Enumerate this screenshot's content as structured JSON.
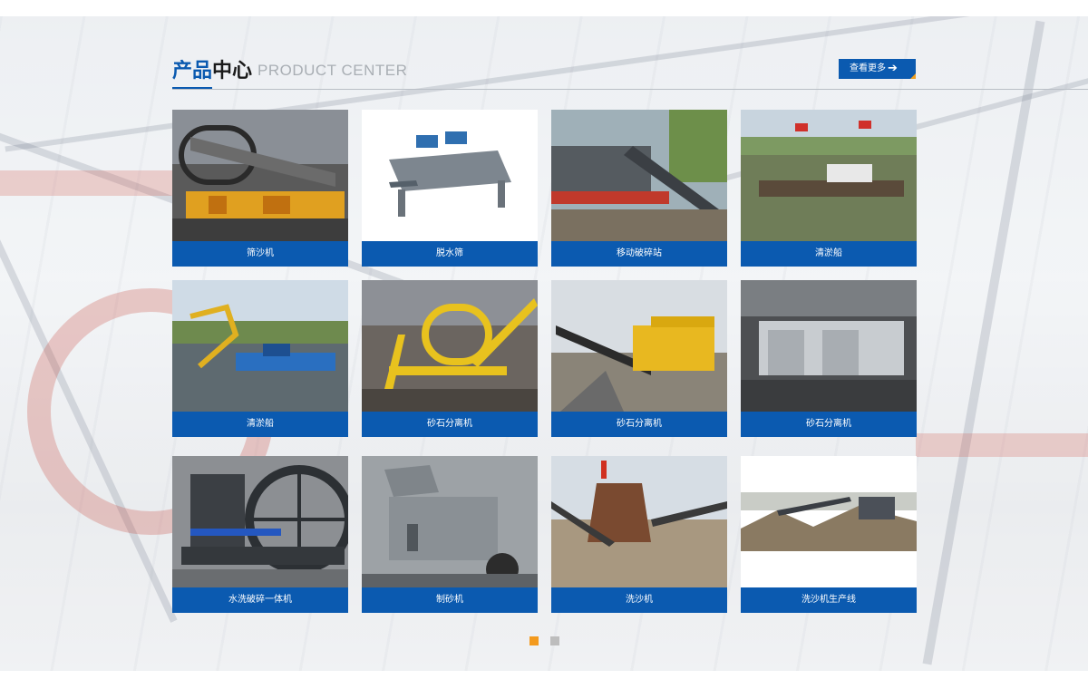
{
  "header": {
    "title_cn_accent": "产品",
    "title_cn_rest": "中心",
    "title_en": "PRODUCT CENTER",
    "more_label": "查看更多",
    "more_icon": "arrow-right-icon"
  },
  "products": [
    {
      "name": "筛沙机"
    },
    {
      "name": "脱水筛"
    },
    {
      "name": "移动破碎站"
    },
    {
      "name": "清淤船"
    },
    {
      "name": "清淤船"
    },
    {
      "name": "砂石分离机"
    },
    {
      "name": "砂石分离机"
    },
    {
      "name": "砂石分离机"
    },
    {
      "name": "水洗破碎一体机"
    },
    {
      "name": "制砂机"
    },
    {
      "name": "洗沙机"
    },
    {
      "name": "洗沙机生产线"
    }
  ],
  "pager": {
    "active_color": "#f39a1e",
    "inactive_color": "#bdbdbd"
  },
  "colors": {
    "brand_blue": "#0b5ab0",
    "accent_orange": "#f0a020"
  }
}
